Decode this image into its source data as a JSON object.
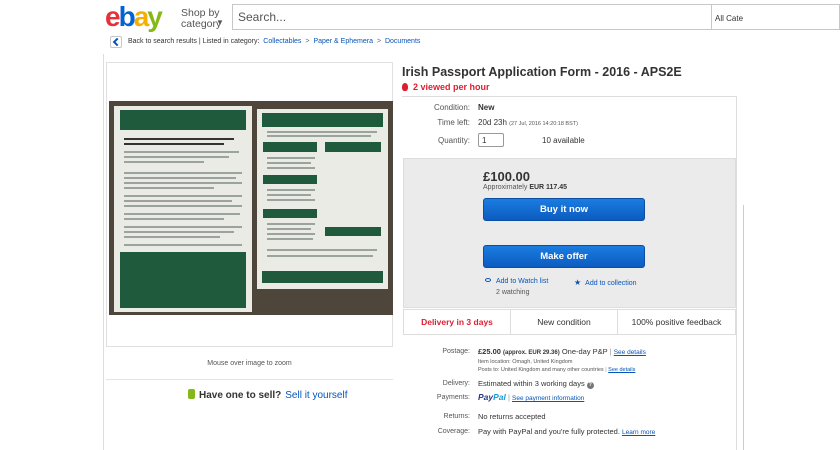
{
  "header": {
    "logo_letters": [
      "e",
      "b",
      "a",
      "y"
    ],
    "shop_by": "Shop by",
    "category": "category",
    "search_placeholder": "Search...",
    "all_categories": "All Cate"
  },
  "breadcrumb": {
    "back": "Back to search results",
    "listed_in": "| Listed in category:",
    "items": [
      "Collectables",
      "Paper & Ephemera",
      "Documents"
    ],
    "sep": ">"
  },
  "gallery": {
    "mouseover": "Mouse over image to zoom",
    "have_one": "Have one to sell?",
    "sell_link": "Sell it yourself"
  },
  "listing": {
    "title": "Irish Passport Application Form - 2016 - APS2E",
    "viewed": "2 viewed per hour",
    "condition_label": "Condition:",
    "condition": "New",
    "time_left_label": "Time left:",
    "time_left": "20d 23h",
    "end_date": "(27 Jul, 2016  14:20:18 BST)",
    "quantity_label": "Quantity:",
    "quantity": "1",
    "available": "10 available"
  },
  "buybox": {
    "price": "£100.00",
    "approx_prefix": "Approximately",
    "approx_value": "EUR 117.45",
    "buy_now": "Buy it now",
    "make_offer": "Make offer",
    "watch": "Add to Watch list",
    "watching": "2 watching",
    "collection": "Add to collection"
  },
  "highlights": {
    "delivery": "Delivery in 3 days",
    "condition": "New condition",
    "feedback": "100% positive feedback"
  },
  "shipping": {
    "postage_label": "Postage:",
    "postage": "£25.00",
    "postage_approx": "(approx. EUR 29.36)",
    "postage_type": "One-day P&P",
    "see_details": "See details",
    "item_location": "Item location:  Omagh, United Kingdom",
    "posts_to": "Posts to: United Kingdom and many other countries",
    "posts_details": "See details",
    "delivery_label": "Delivery:",
    "delivery": "Estimated within 3 working days",
    "payments_label": "Payments:",
    "paypal_pay": "Pay",
    "paypal_pal": "Pal",
    "payment_info": "See payment information",
    "returns_label": "Returns:",
    "returns": "No returns accepted",
    "coverage_label": "Coverage:",
    "coverage": "Pay with PayPal and you're fully protected.",
    "learn_more": "Learn more"
  },
  "colors": {
    "ebay_e": "#e53238",
    "ebay_b": "#0064d2",
    "ebay_a": "#f5af02",
    "ebay_y": "#86b817"
  }
}
